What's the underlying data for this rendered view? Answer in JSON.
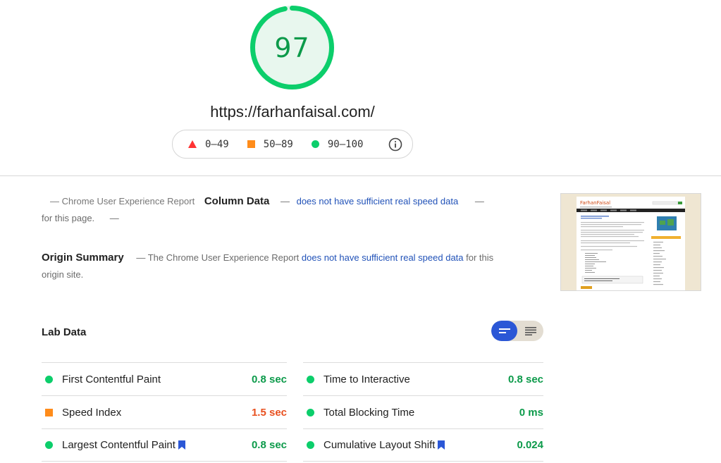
{
  "summary": {
    "score": "97",
    "score_fraction": 0.97,
    "url": "https://farhanfaisal.com/",
    "legend": [
      {
        "range": "0–49",
        "shape": "triangle",
        "color": "#ff3333"
      },
      {
        "range": "50–89",
        "shape": "square",
        "color": "#ff8c1a"
      },
      {
        "range": "90–100",
        "shape": "circle",
        "color": "#0cce6b"
      }
    ],
    "info_icon": "info-icon"
  },
  "field_data": {
    "prefix": "— Chrome User Experience Report",
    "heading": "Column Data",
    "sep": "—",
    "link": "does not have sufficient real speed data",
    "sep2": "—",
    "suffix": "for this page.",
    "sep3": "—"
  },
  "origin": {
    "heading": "Origin Summary",
    "prefix": "— The Chrome User Experience Report",
    "link": "does not have sufficient real speed data",
    "suffix": "for this origin site."
  },
  "screenshot": {
    "site_name": "FarhanFaisal"
  },
  "lab": {
    "title": "Lab Data",
    "toggle_icons": [
      "compact-view-icon",
      "expanded-view-icon"
    ],
    "left": [
      {
        "name": "First Contentful Paint",
        "value": "0.8 sec",
        "status": "pass",
        "bookmark": false
      },
      {
        "name": "Speed Index",
        "value": "1.5 sec",
        "status": "average",
        "bookmark": false
      },
      {
        "name": "Largest Contentful Paint",
        "value": "0.8 sec",
        "status": "pass",
        "bookmark": true
      }
    ],
    "right": [
      {
        "name": "Time to Interactive",
        "value": "0.8 sec",
        "status": "pass",
        "bookmark": false
      },
      {
        "name": "Total Blocking Time",
        "value": "0 ms",
        "status": "pass",
        "bookmark": false
      },
      {
        "name": "Cumulative Layout Shift",
        "value": "0.024",
        "status": "pass",
        "bookmark": true
      }
    ]
  },
  "colors": {
    "pass": "#0cce6b",
    "pass_text": "#0c9a4a",
    "average": "#ff8c1a",
    "average_text": "#e8501f",
    "fail": "#ff3333",
    "link": "#2152b8",
    "accent": "#2b57d6"
  }
}
